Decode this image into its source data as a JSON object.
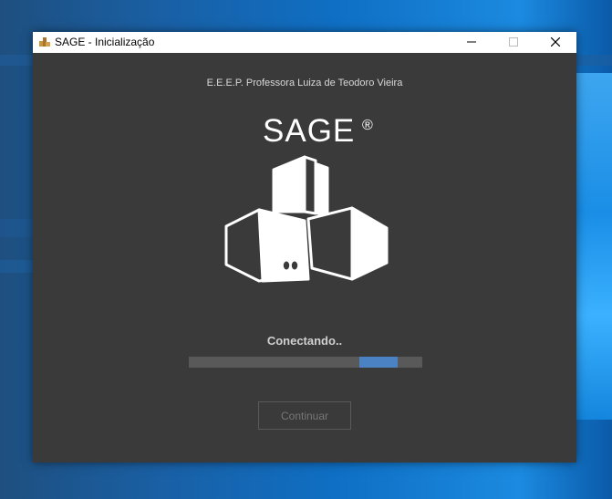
{
  "window": {
    "title": "SAGE - Inicialização",
    "icon": "sage-app-icon"
  },
  "header": {
    "school_name": "E.E.E.P. Professora Luiza de Teodoro Vieira"
  },
  "logo": {
    "title": "SAGE",
    "registered": "®",
    "graphic": "buildings-logo-icon"
  },
  "status": {
    "text": "Conectando.."
  },
  "progress": {
    "indeterminate": true,
    "fill_color": "#4b82c4",
    "track_color": "#595959"
  },
  "actions": {
    "continue_label": "Continuar",
    "continue_enabled": false
  },
  "colors": {
    "window_bg": "#3a3a3a",
    "accent": "#4b82c4"
  }
}
